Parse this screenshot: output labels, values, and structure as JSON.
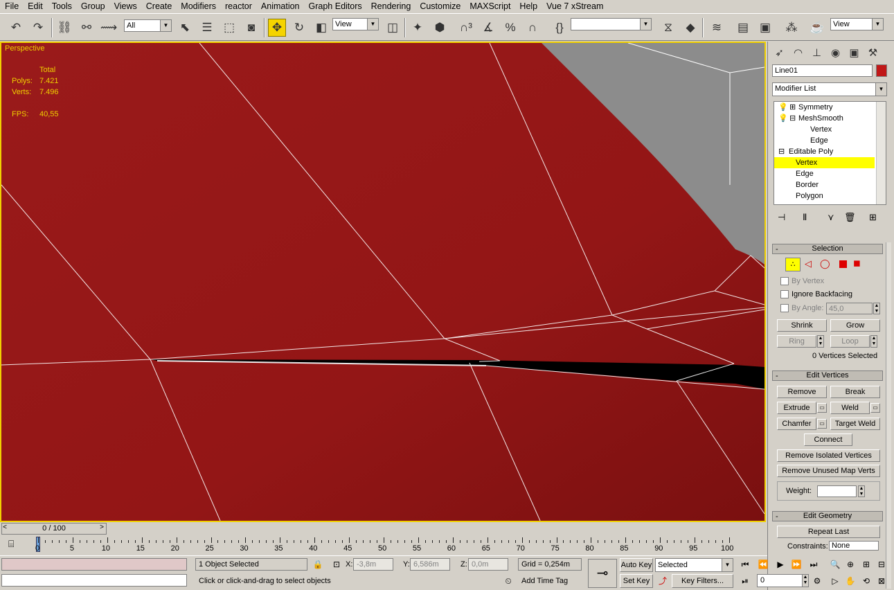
{
  "menu": [
    "File",
    "Edit",
    "Tools",
    "Group",
    "Views",
    "Create",
    "Modifiers",
    "reactor",
    "Animation",
    "Graph Editors",
    "Rendering",
    "Customize",
    "MAXScript",
    "Help",
    "Vue 7 xStream"
  ],
  "toolbar": {
    "filter_value": "All",
    "refcoord_value": "View",
    "named_sel_value": "",
    "view_combo_value": "View"
  },
  "viewport": {
    "label": "Perspective",
    "stats_header": "Total",
    "polys_label": "Polys:",
    "polys_value": "7.421",
    "verts_label": "Verts:",
    "verts_value": "7.496",
    "fps_label": "FPS:",
    "fps_value": "40,55",
    "mesh_color": "#961818",
    "accent": "#f0d000"
  },
  "panel": {
    "object_name": "Line01",
    "object_color": "#c01818",
    "modifier_list": "Modifier List",
    "stack": [
      {
        "label": "Symmetry"
      },
      {
        "label": "MeshSmooth"
      },
      {
        "label": "Vertex"
      },
      {
        "label": "Edge"
      },
      {
        "label": "Editable Poly"
      },
      {
        "label": "Vertex"
      },
      {
        "label": "Edge"
      },
      {
        "label": "Border"
      },
      {
        "label": "Polygon"
      }
    ],
    "selection": {
      "title": "Selection",
      "by_vertex": "By Vertex",
      "ignore_backfacing": "Ignore Backfacing",
      "by_angle": "By Angle:",
      "angle_value": "45,0",
      "shrink": "Shrink",
      "grow": "Grow",
      "ring": "Ring",
      "loop": "Loop",
      "status": "0 Vertices Selected"
    },
    "edit_vertices": {
      "title": "Edit Vertices",
      "remove": "Remove",
      "break": "Break",
      "extrude": "Extrude",
      "weld": "Weld",
      "chamfer": "Chamfer",
      "target_weld": "Target Weld",
      "connect": "Connect",
      "remove_isolated": "Remove Isolated Vertices",
      "remove_unused": "Remove Unused Map Verts",
      "weight": "Weight:"
    },
    "edit_geometry": {
      "title": "Edit Geometry",
      "repeat_last": "Repeat Last",
      "constraints": "Constraints:",
      "constraints_value": "None"
    }
  },
  "timeline": {
    "slider": "0 / 100",
    "ticks": [
      "0",
      "5",
      "10",
      "15",
      "20",
      "25",
      "30",
      "35",
      "40",
      "45",
      "50",
      "55",
      "60",
      "65",
      "70",
      "75",
      "80",
      "85",
      "90",
      "95",
      "100"
    ]
  },
  "status": {
    "selected_count": "1 Object Selected",
    "prompt": "Click or click-and-drag to select objects",
    "x_label": "X:",
    "x_value": "-3,8m",
    "y_label": "Y:",
    "y_value": "6,586m",
    "z_label": "Z:",
    "z_value": "0,0m",
    "grid": "Grid = 0,254m",
    "add_time_tag": "Add Time Tag",
    "auto_key": "Auto Key",
    "set_key": "Set Key",
    "key_mode": "Selected",
    "key_filters": "Key Filters...",
    "frame": "0"
  }
}
